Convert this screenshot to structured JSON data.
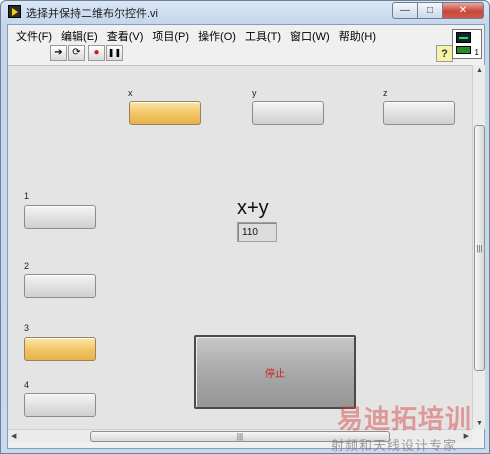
{
  "window": {
    "title": "选择并保持二维布尔控件.vi",
    "controls": {
      "minimize": "—",
      "maximize": "□",
      "close": "✕"
    }
  },
  "menubar": {
    "items": [
      "文件(F)",
      "编辑(E)",
      "查看(V)",
      "项目(P)",
      "操作(O)",
      "工具(T)",
      "窗口(W)",
      "帮助(H)"
    ]
  },
  "toolbar": {
    "run_icon": "➔",
    "run_continuous_icon": "⟳",
    "abort_icon": "●",
    "pause_icon": "❚❚",
    "help_label": "?",
    "connector_number": "1"
  },
  "panel": {
    "top_controls": [
      {
        "label": "x",
        "state": "on"
      },
      {
        "label": "y",
        "state": "off"
      },
      {
        "label": "z",
        "state": "off"
      }
    ],
    "left_controls": [
      {
        "label": "1",
        "state": "off"
      },
      {
        "label": "2",
        "state": "off"
      },
      {
        "label": "3",
        "state": "on"
      },
      {
        "label": "4",
        "state": "off"
      }
    ],
    "sum_indicator": {
      "label": "x+y",
      "value": "110"
    },
    "stop_button": {
      "label": "停止"
    }
  },
  "scrollbars": {
    "thumb_grip": "|||"
  },
  "watermark": {
    "logo": "易迪拓培训",
    "subtitle": "射频和天线设计专家"
  },
  "colors": {
    "active": "#f1c465",
    "inactive": "#d6d6d6",
    "stop_text": "#d11a1a"
  }
}
